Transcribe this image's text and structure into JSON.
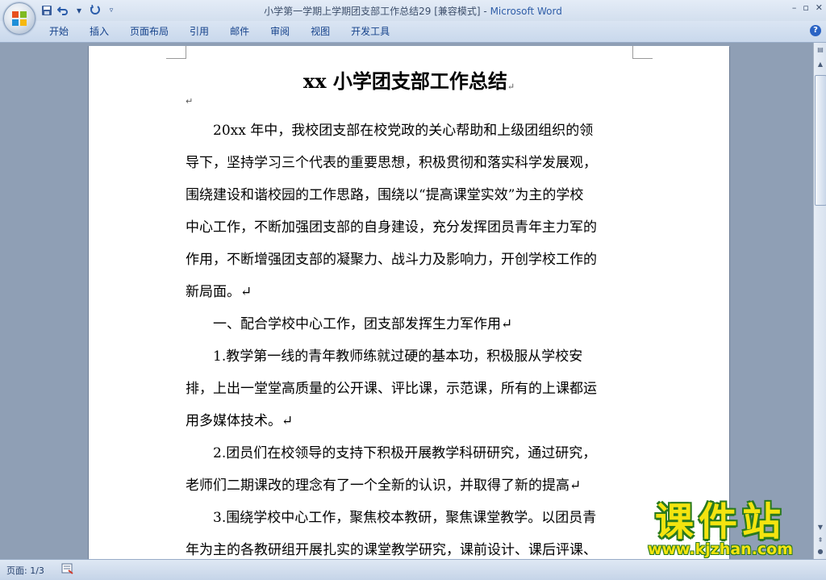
{
  "window": {
    "doc_name": "小学第一学期上学期团支部工作总结29 [兼容模式]",
    "separator": " - ",
    "app_name": "Microsoft Word",
    "controls": [
      "–",
      "▫",
      "✕"
    ]
  },
  "ribbon": {
    "tabs": [
      "开始",
      "插入",
      "页面布局",
      "引用",
      "邮件",
      "审阅",
      "视图",
      "开发工具"
    ],
    "help": "?"
  },
  "document": {
    "title": "xx 小学团支部工作总结",
    "para_mark": "↵",
    "paragraphs": [
      {
        "indent": true,
        "lines": [
          "20xx 年中，我校团支部在校党政的关心帮助和上级团组织的领",
          "导下，坚持学习三个代表的重要思想，积极贯彻和落实科学发展观，",
          "围绕建设和谐校园的工作思路，围绕以“提高课堂实效”为主的学校",
          "中心工作，不断加强团支部的自身建设，充分发挥团员青年主力军的",
          "作用，不断增强团支部的凝聚力、战斗力及影响力，开创学校工作的",
          "新局面。↵"
        ]
      },
      {
        "indent": true,
        "lines": [
          "一、配合学校中心工作，团支部发挥生力军作用↵"
        ]
      },
      {
        "indent": true,
        "lines": [
          "1.教学第一线的青年教师练就过硬的基本功，积极服从学校安",
          "排，上出一堂堂高质量的公开课、评比课，示范课，所有的上课都运",
          "用多媒体技术。↵"
        ]
      },
      {
        "indent": true,
        "lines": [
          "2.团员们在校领导的支持下积极开展教学科研研究，通过研究，",
          "老师们二期课改的理念有了一个全新的认识，并取得了新的提高↵"
        ]
      },
      {
        "indent": true,
        "lines": [
          "3.围绕学校中心工作，聚焦校本教研，聚焦课堂教学。以团员青",
          "年为主的各教研组开展扎实的课堂教学研究，课前设计、课后评课、"
        ]
      }
    ]
  },
  "status": {
    "page_info": "页面: 1/3"
  },
  "watermark": {
    "brand": "课件站",
    "url": "www.kjzhan.com"
  }
}
